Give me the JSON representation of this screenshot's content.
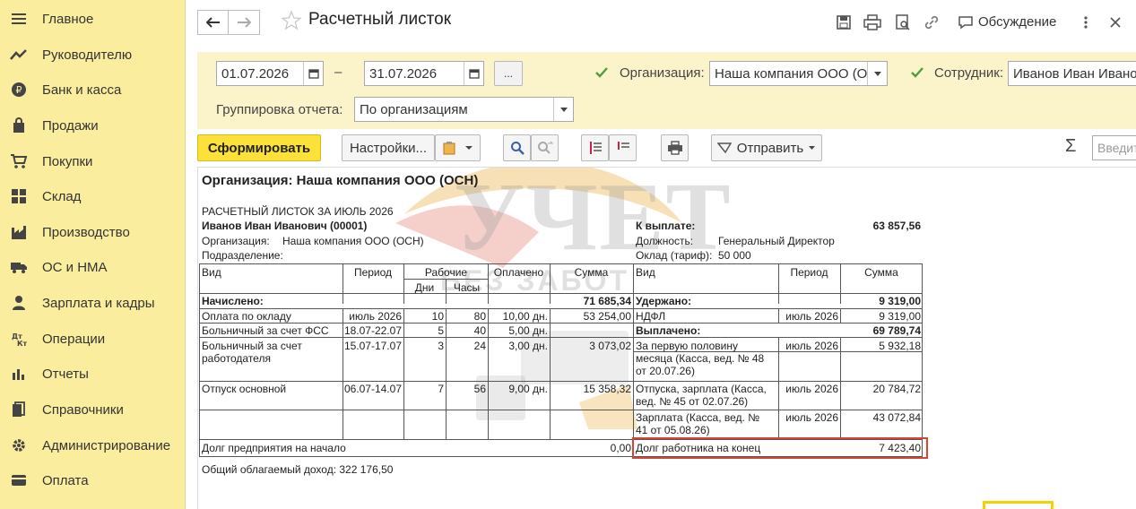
{
  "sidebar": {
    "items": [
      {
        "label": "Главное",
        "icon": "menu-lines-icon"
      },
      {
        "label": "Руководителю",
        "icon": "chart-line-icon"
      },
      {
        "label": "Банк и касса",
        "icon": "ruble-coin-icon"
      },
      {
        "label": "Продажи",
        "icon": "shopping-bag-icon"
      },
      {
        "label": "Покупки",
        "icon": "cart-icon"
      },
      {
        "label": "Склад",
        "icon": "grid-icon"
      },
      {
        "label": "Производство",
        "icon": "factory-icon"
      },
      {
        "label": "ОС и НМА",
        "icon": "truck-icon"
      },
      {
        "label": "Зарплата и кадры",
        "icon": "person-icon"
      },
      {
        "label": "Операции",
        "icon": "dt-kt-icon"
      },
      {
        "label": "Отчеты",
        "icon": "bar-chart-icon"
      },
      {
        "label": "Справочники",
        "icon": "books-icon"
      },
      {
        "label": "Администрирование",
        "icon": "gear-icon"
      },
      {
        "label": "Оплата",
        "icon": "card-icon"
      }
    ]
  },
  "header": {
    "title": "Расчетный листок",
    "discuss_label": "Обсуждение"
  },
  "filters": {
    "date_from": "01.07.2026",
    "date_to": "31.07.2026",
    "dash": "–",
    "ellipsis": "...",
    "org_label": "Организация:",
    "org_value": "Наша компания ООО (ОС",
    "emp_label": "Сотрудник:",
    "emp_value": "Иванов Иван Иванови",
    "group_label": "Группировка отчета:",
    "group_value": "По организациям"
  },
  "commands": {
    "generate": "Сформировать",
    "settings": "Настройки...",
    "send": "Отправить",
    "sigma": "Σ",
    "search_placeholder": "Введит..."
  },
  "report": {
    "org_title": "Организация: Наша компания ООО (ОСН)",
    "sheet_title": "РАСЧЕТНЫЙ ЛИСТОК ЗА ИЮЛЬ 2026",
    "employee": "Иванов Иван Иванович (00001)",
    "org_label": "Организация:",
    "org_value": "Наша компания ООО (ОСН)",
    "dept_label": "Подразделение:",
    "to_pay_label": "К выплате:",
    "to_pay_value": "63 857,56",
    "position_label": "Должность:",
    "position_value": "Генеральный Директор",
    "salary_label": "Оклад (тариф):",
    "salary_value": "50 000",
    "left_headers": {
      "kind": "Вид",
      "period": "Период",
      "work": "Рабочие",
      "days": "Дни",
      "hours": "Часы",
      "paid": "Оплачено",
      "sum": "Сумма"
    },
    "right_headers": {
      "kind": "Вид",
      "period": "Период",
      "sum": "Сумма"
    },
    "accrued_label": "Начислено:",
    "accrued_value": "71 685,34",
    "withheld_label": "Удержано:",
    "withheld_value": "9 319,00",
    "paid_label": "Выплачено:",
    "paid_value": "69 789,74",
    "left_rows": [
      {
        "kind": "Оплата по окладу",
        "period": "июль 2026",
        "days": "10",
        "hours": "80",
        "paid": "10,00 дн.",
        "sum": "53 254,00"
      },
      {
        "kind": "Больничный за счет ФСС",
        "period": "18.07-22.07",
        "days": "5",
        "hours": "40",
        "paid": "5,00 дн.",
        "sum": ""
      },
      {
        "kind": "Больничный за счет",
        "kind2": "работодателя",
        "period": "15.07-17.07",
        "days": "3",
        "hours": "24",
        "paid": "3,00 дн.",
        "sum": "3 073,02"
      },
      {
        "kind": "Отпуск основной",
        "period": "06.07-14.07",
        "days": "7",
        "hours": "56",
        "paid": "9,00 дн.",
        "sum": "15 358,32"
      }
    ],
    "right_rows": [
      {
        "kind": "НДФЛ",
        "period": "июль 2026",
        "sum": "9 319,00"
      },
      {
        "kind": "За первую половину",
        "kind2": "месяца (Касса, вед. № 48",
        "kind3": "от 20.07.26)",
        "period": "июль 2026",
        "sum": "5 932,18"
      },
      {
        "kind": "Отпуска, зарплата (Касса,",
        "kind2": "вед. № 45 от 02.07.26)",
        "period": "июль 2026",
        "sum": "20 784,72"
      },
      {
        "kind": "Зарплата (Касса, вед. №",
        "kind2": "41 от 05.08.26)",
        "period": "июль 2026",
        "sum": "43 072,84"
      }
    ],
    "debt_start_label": "Долг предприятия на начало",
    "debt_start_value": "0,00",
    "debt_end_label": "Долг работника на конец",
    "debt_end_value": "7 423,40",
    "taxable_income": "Общий облагаемый доход: 322 176,50"
  },
  "watermark": {
    "line1": "УЧЕТ",
    "line2": "БЕЗ ЗАБОТ"
  },
  "colors": {
    "sidebar": "#fbed9e",
    "filter_panel": "#fbf3c9",
    "primary_button": "#fbe13a",
    "highlight": "#d9432f"
  }
}
